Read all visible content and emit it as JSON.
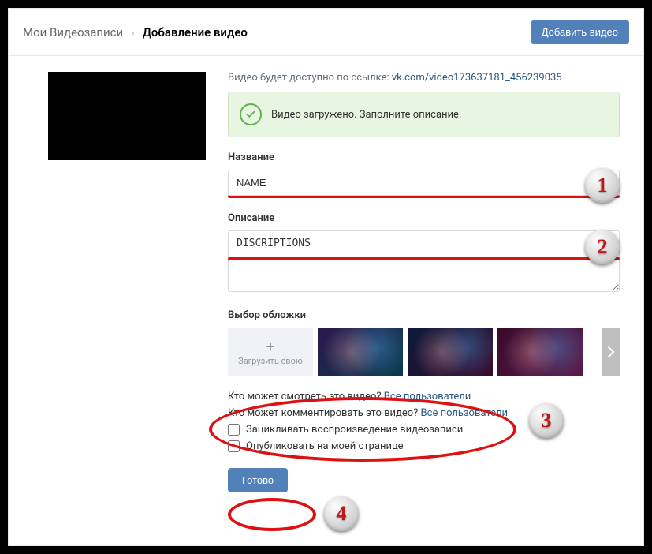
{
  "header": {
    "crumb1": "Мои Видеозаписи",
    "separator": "›",
    "crumb2": "Добавление видео",
    "add_button": "Добавить видео"
  },
  "link_line": {
    "prefix": "Видео будет доступно по ссылке: ",
    "url_text": "vk.com/video173637181_456239035"
  },
  "success": {
    "message": "Видео загружено. Заполните описание."
  },
  "fields": {
    "name_label": "Название",
    "name_value": "NAME",
    "desc_label": "Описание",
    "desc_value": "DISCRIPTIONS",
    "cover_label": "Выбор обложки",
    "upload_cover": "Загрузить свою"
  },
  "privacy": {
    "view_q": "Кто может смотреть это видео? ",
    "view_a": "Все пользователи",
    "comment_q": "Кто может комментировать это видео? ",
    "comment_a": "Все пользователи"
  },
  "checks": {
    "loop": "Зацикливать воспроизведение видеозаписи",
    "publish": "Опубликовать на моей странице"
  },
  "actions": {
    "done": "Готово"
  },
  "annotations": {
    "b1": "1",
    "b2": "2",
    "b3": "3",
    "b4": "4"
  }
}
